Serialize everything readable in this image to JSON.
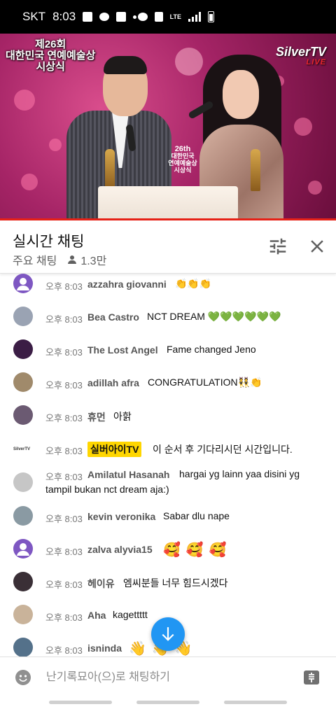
{
  "status_bar": {
    "carrier": "SKT",
    "time": "8:03",
    "network": "LTE"
  },
  "video": {
    "event_title_lines": [
      "제26회",
      "대한민국 연예예술상",
      "시상식"
    ],
    "channel_logo": "SilverTV",
    "live_label": "LIVE",
    "emblem": {
      "number": "26th",
      "line1": "대한민국",
      "line2": "연예예술상",
      "line3": "시상식"
    },
    "progress_color": "#e62117"
  },
  "chat_header": {
    "title": "실시간 채팅",
    "mode": "주요 채팅",
    "viewers": "1.3만",
    "filter_icon": "tune-icon",
    "close_icon": "close-icon"
  },
  "messages": [
    {
      "time": "오후 8:03",
      "author": "azzahra giovanni",
      "text": "👏👏👏",
      "avatar_color": "#7e57c2",
      "avatar_type": "default"
    },
    {
      "time": "오후 8:03",
      "author": "Bea Castro",
      "text": "NCT DREAM 💚💚💚💚💚💚",
      "avatar_color": "#9aa3b3",
      "avatar_type": "photo"
    },
    {
      "time": "오후 8:03",
      "author": "The Lost Angel",
      "text": "Fame changed Jeno",
      "avatar_color": "#3b1d45",
      "avatar_type": "photo"
    },
    {
      "time": "오후 8:03",
      "author": "adillah afra",
      "text": "CONGRATULATION👯👏",
      "avatar_color": "#a08a6b",
      "avatar_type": "photo"
    },
    {
      "time": "오후 8:03",
      "author": "휴먼",
      "text": "아핡",
      "avatar_color": "#6b5a72",
      "avatar_type": "photo"
    },
    {
      "time": "오후 8:03",
      "author": "실버아이TV",
      "text": "이 순서 후 기다리시던 시간입니다.",
      "avatar_color": "#ffffff",
      "avatar_type": "logo",
      "owner": true
    },
    {
      "time": "오후 8:03",
      "author": "Amilatul Hasanah",
      "text": "hargai yg lainn yaa disini yg",
      "text2": "tampil bukan nct dream aja:)",
      "avatar_color": "#c6c6c6",
      "avatar_type": "photo"
    },
    {
      "time": "오후 8:03",
      "author": "kevin veronika",
      "text": "Sabar dlu nape",
      "avatar_color": "#8a9aa3",
      "avatar_type": "photo"
    },
    {
      "time": "오후 8:03",
      "author": "zalva alyvia15",
      "text": "🥰🥰🥰",
      "avatar_color": "#7e57c2",
      "avatar_type": "default"
    },
    {
      "time": "오후 8:03",
      "author": "헤이유",
      "text": "엠씨분들 너무 힘드시겠다",
      "avatar_color": "#3a2f36",
      "avatar_type": "photo"
    },
    {
      "time": "오후 8:03",
      "author": "Aha",
      "text": "kagettttt",
      "avatar_color": "#c9b39a",
      "avatar_type": "photo"
    },
    {
      "time": "오후 8:03",
      "author": "isninda",
      "text": "👋👋👋",
      "avatar_color": "#54718a",
      "avatar_type": "photo"
    }
  ],
  "scroll_button": {
    "icon": "arrow-down-icon",
    "color": "#2196f3"
  },
  "input_bar": {
    "placeholder": "난기록묘아(으)로 채팅하기",
    "emoji_icon": "emoji-icon",
    "superchat_icon": "super-chat-icon"
  }
}
